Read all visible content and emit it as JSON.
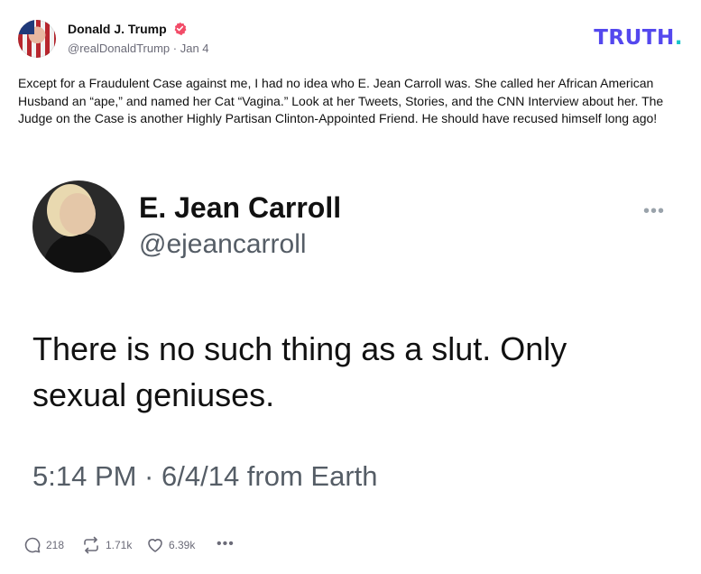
{
  "post": {
    "author_name": "Donald J. Trump",
    "handle": "@realDonaldTrump",
    "separator": " · ",
    "date": "Jan 4",
    "text": "Except for a Fraudulent Case against me, I had no idea who E. Jean Carroll was. She called her African American Husband an “ape,” and named her Cat “Vagina.” Look at her Tweets, Stories, and the CNN Interview about her. The Judge on the Case is another Highly Partisan Clinton-Appointed Friend. He should have recused himself long ago!"
  },
  "brand": {
    "logo_text": "TRUTH",
    "logo_dot": ".",
    "color": "#5448ee",
    "dot_color": "#17c3c9"
  },
  "embedded_tweet": {
    "name": "E. Jean Carroll",
    "handle": "@ejeancarroll",
    "more": "•••",
    "text": "There is no such thing as a slut. Only sexual geniuses.",
    "timestamp": "5:14 PM · 6/4/14 from Earth"
  },
  "actions": {
    "replies": "218",
    "retruths": "1.71k",
    "likes": "6.39k",
    "more": "•••"
  },
  "icons": {
    "verified": "verified-badge-icon",
    "reply": "speech-bubble-icon",
    "retruth": "repost-arrows-icon",
    "like": "heart-icon",
    "more": "ellipsis-icon"
  }
}
